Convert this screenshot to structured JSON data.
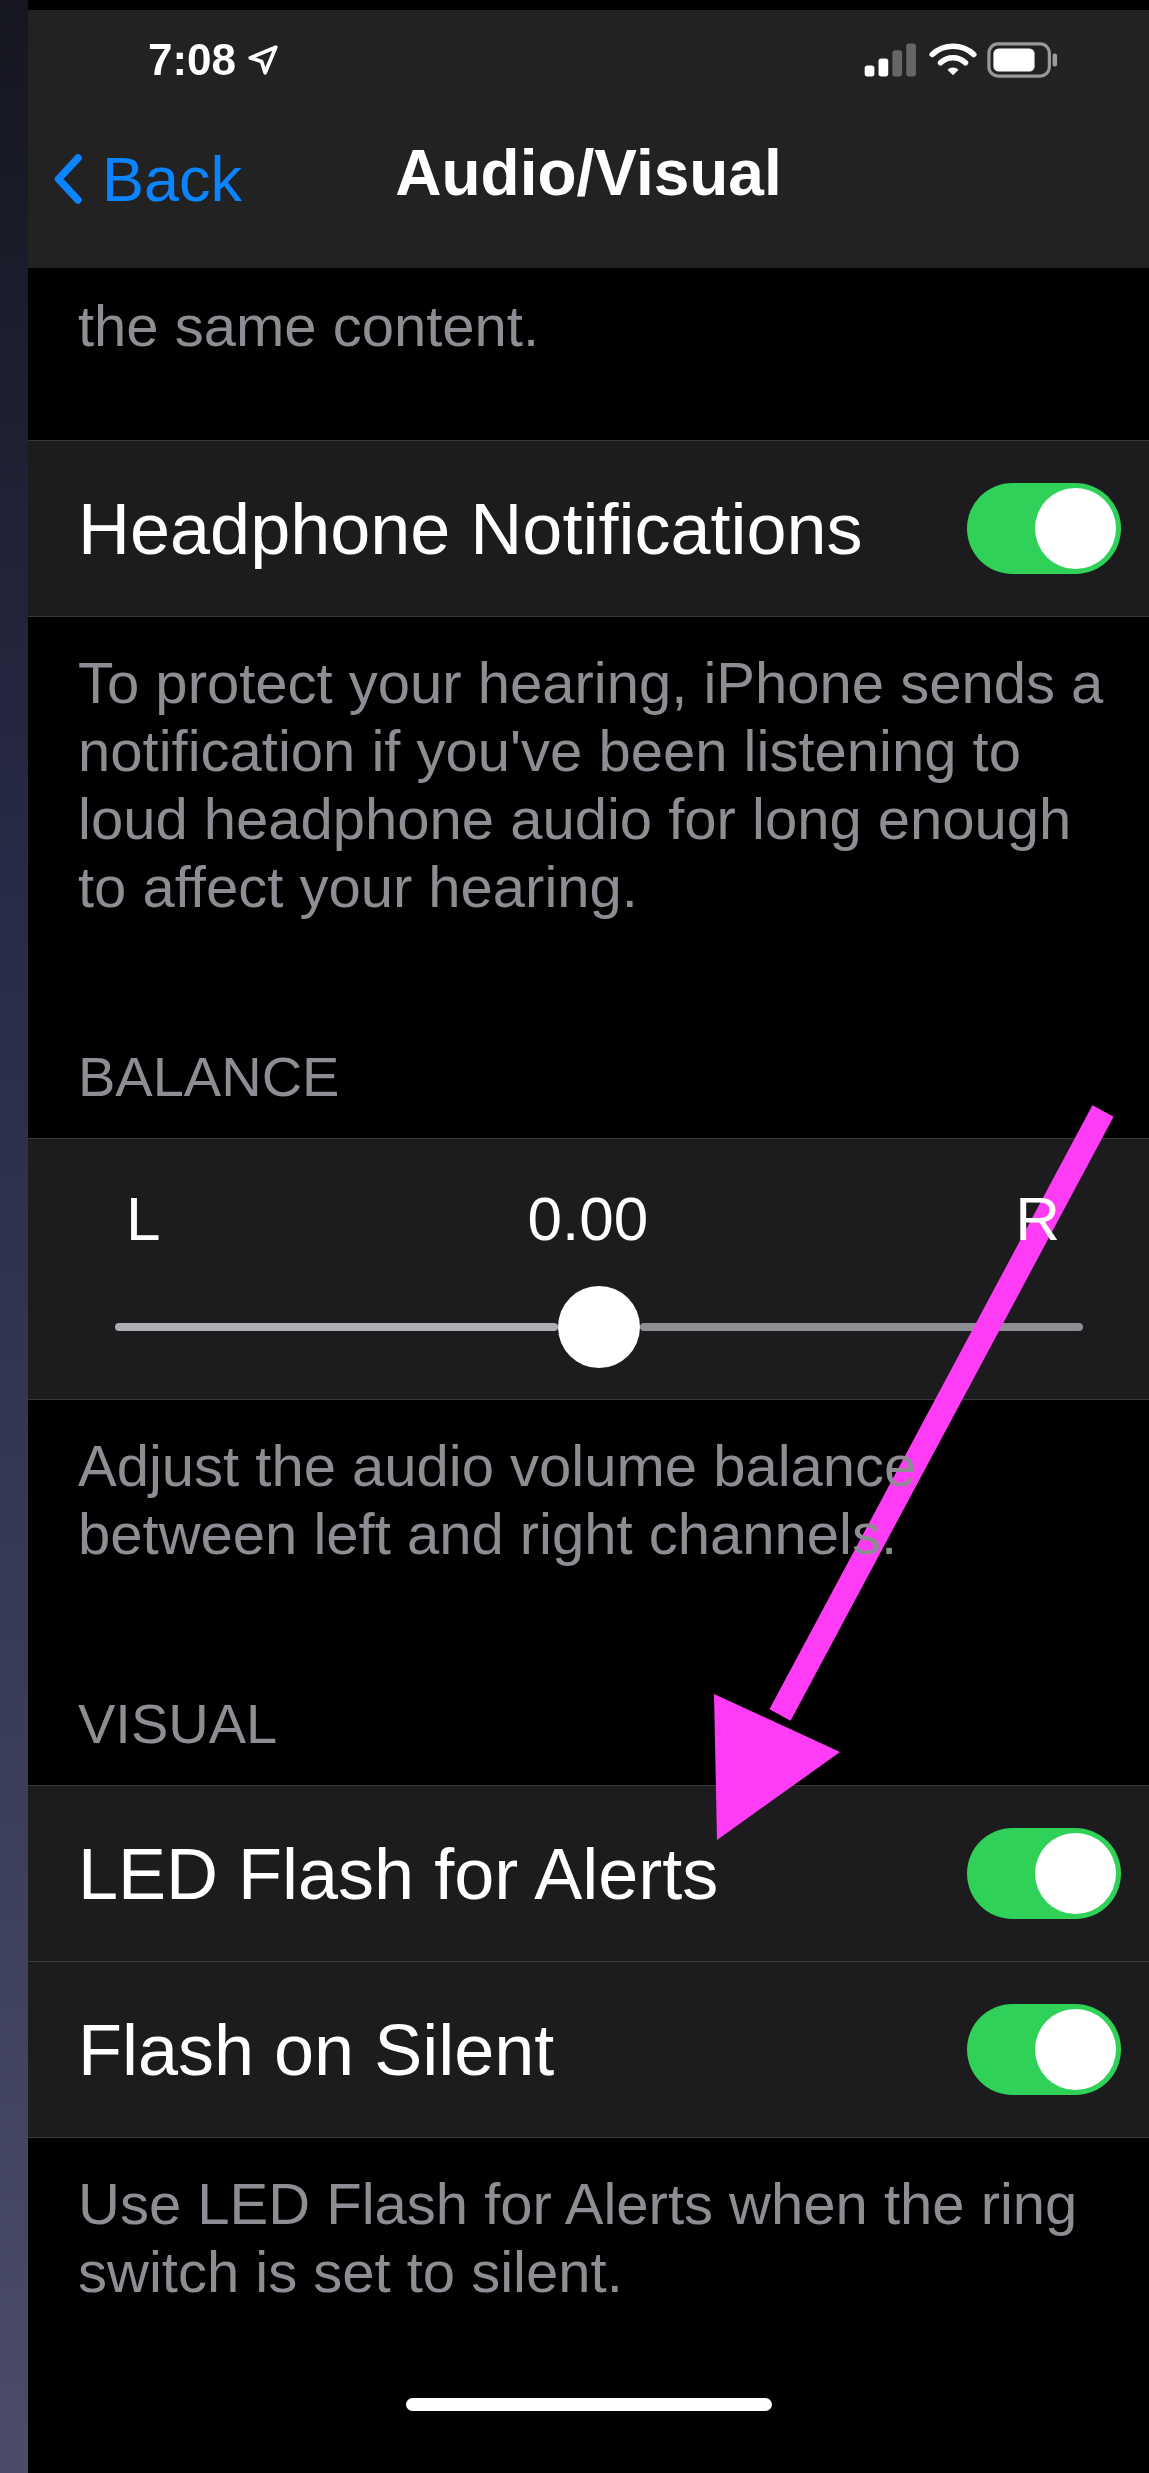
{
  "status_bar": {
    "time": "7:08"
  },
  "nav": {
    "back": "Back",
    "title": "Audio/Visual"
  },
  "blocks": [
    {
      "kind": "footer",
      "text": "the same content."
    },
    {
      "kind": "group",
      "rows": [
        {
          "kind": "toggle",
          "label": "Headphone Notifications",
          "on": true
        }
      ]
    },
    {
      "kind": "footer",
      "text": "To protect your hearing, iPhone sends a notification if you've been listening to loud headphone audio for long enough to affect your hearing."
    },
    {
      "kind": "header",
      "text": "BALANCE"
    },
    {
      "kind": "group",
      "rows": [
        {
          "kind": "slider",
          "left": "L",
          "reading": "0.00",
          "right": "R",
          "level": 0.5
        }
      ]
    },
    {
      "kind": "footer",
      "text": "Adjust the audio volume balance between left and right channels."
    },
    {
      "kind": "header",
      "text": "VISUAL"
    },
    {
      "kind": "group",
      "rows": [
        {
          "kind": "toggle",
          "label": "LED Flash for Alerts",
          "on": true
        },
        {
          "kind": "toggle",
          "label": "Flash on Silent",
          "on": true
        }
      ]
    },
    {
      "kind": "footer",
      "text": "Use LED Flash for Alerts when the ring switch is set to silent."
    }
  ]
}
